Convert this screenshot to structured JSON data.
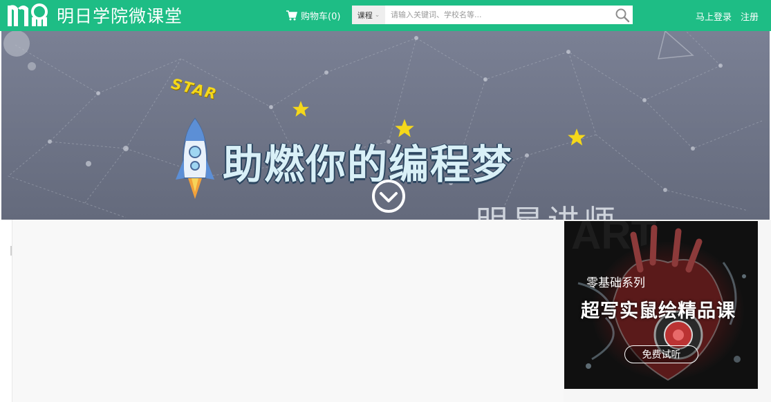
{
  "header": {
    "site_name": "明日学院微课堂",
    "cart_label": "购物车(0)",
    "search": {
      "category": "课程",
      "placeholder": "请输入关键词、学校名等..."
    },
    "login_label": "马上登录",
    "register_label": "注册"
  },
  "banner": {
    "star_label": "STAR",
    "headline": "助燃你的编程梦",
    "subtitle": "明星讲师"
  },
  "ad": {
    "series": "零基础系列",
    "title": "超写实鼠绘精品课",
    "button": "免费试听"
  },
  "colors": {
    "brand_green": "#1ebd85",
    "banner_bg": "#6f7688"
  },
  "icons": {
    "cart": "cart-icon",
    "search": "search-icon",
    "chevron": "chevron-down-icon",
    "scroll": "scroll-down-icon"
  }
}
